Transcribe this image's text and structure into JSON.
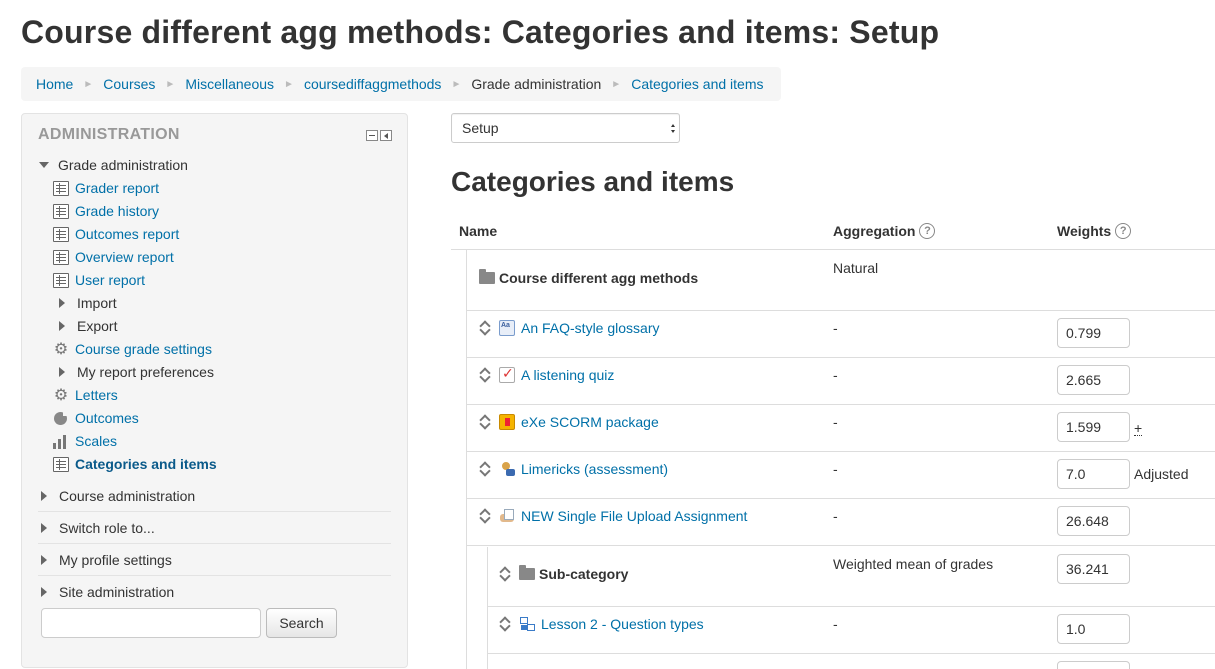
{
  "page": {
    "title": "Course different agg methods: Categories and items: Setup"
  },
  "breadcrumb": [
    {
      "label": "Home",
      "link": true
    },
    {
      "label": "Courses",
      "link": true
    },
    {
      "label": "Miscellaneous",
      "link": true
    },
    {
      "label": "coursediffaggmethods",
      "link": true
    },
    {
      "label": "Grade administration",
      "link": false
    },
    {
      "label": "Categories and items",
      "link": true
    }
  ],
  "admin_block": {
    "title": "ADMINISTRATION",
    "grade_admin_label": "Grade administration",
    "items": [
      {
        "label": "Grader report",
        "icon": "report-icon",
        "type": "link"
      },
      {
        "label": "Grade history",
        "icon": "report-icon",
        "type": "link"
      },
      {
        "label": "Outcomes report",
        "icon": "report-icon",
        "type": "link"
      },
      {
        "label": "Overview report",
        "icon": "report-icon",
        "type": "link"
      },
      {
        "label": "User report",
        "icon": "report-icon",
        "type": "link"
      },
      {
        "label": "Import",
        "icon": "expand-right-icon",
        "type": "branch"
      },
      {
        "label": "Export",
        "icon": "expand-right-icon",
        "type": "branch"
      },
      {
        "label": "Course grade settings",
        "icon": "gear-icon",
        "type": "link"
      },
      {
        "label": "My report preferences",
        "icon": "expand-right-icon",
        "type": "branch"
      },
      {
        "label": "Letters",
        "icon": "gear-icon",
        "type": "link"
      },
      {
        "label": "Outcomes",
        "icon": "pie-icon",
        "type": "link"
      },
      {
        "label": "Scales",
        "icon": "bar-chart-icon",
        "type": "link"
      },
      {
        "label": "Categories and items",
        "icon": "report-icon",
        "type": "active"
      }
    ],
    "sections": [
      {
        "label": "Course administration"
      },
      {
        "label": "Switch role to..."
      },
      {
        "label": "My profile settings"
      },
      {
        "label": "Site administration"
      }
    ],
    "search": {
      "value": "",
      "placeholder": "",
      "button_label": "Search"
    }
  },
  "main": {
    "select_value": "Setup",
    "section_title": "Categories and items",
    "table": {
      "headers": {
        "name": "Name",
        "aggregation": "Aggregation",
        "weights": "Weights"
      },
      "rows": [
        {
          "kind": "category",
          "name": "Course different agg methods",
          "aggregation": "Natural",
          "weight": null,
          "note": ""
        },
        {
          "kind": "item",
          "icon": "glossary-icon",
          "name": "An FAQ-style glossary",
          "aggregation": "-",
          "weight": "0.799",
          "note": ""
        },
        {
          "kind": "item",
          "icon": "quiz-icon",
          "name": "A listening quiz",
          "aggregation": "-",
          "weight": "2.665",
          "note": ""
        },
        {
          "kind": "item",
          "icon": "scorm-icon",
          "name": "eXe SCORM package",
          "aggregation": "-",
          "weight": "1.599",
          "note": "+"
        },
        {
          "kind": "item",
          "icon": "workshop-icon",
          "name": "Limericks (assessment)",
          "aggregation": "-",
          "weight": "7.0",
          "note": "Adjusted"
        },
        {
          "kind": "item",
          "icon": "assignment-icon",
          "name": "NEW Single File Upload Assignment",
          "aggregation": "-",
          "weight": "26.648",
          "note": ""
        },
        {
          "kind": "subcategory",
          "name": "Sub-category",
          "aggregation": "Weighted mean of grades",
          "weight": "36.241",
          "note": ""
        },
        {
          "kind": "subitem",
          "icon": "lesson-icon",
          "name": "Lesson 2 - Question types",
          "aggregation": "-",
          "weight": "1.0",
          "note": ""
        }
      ]
    }
  }
}
